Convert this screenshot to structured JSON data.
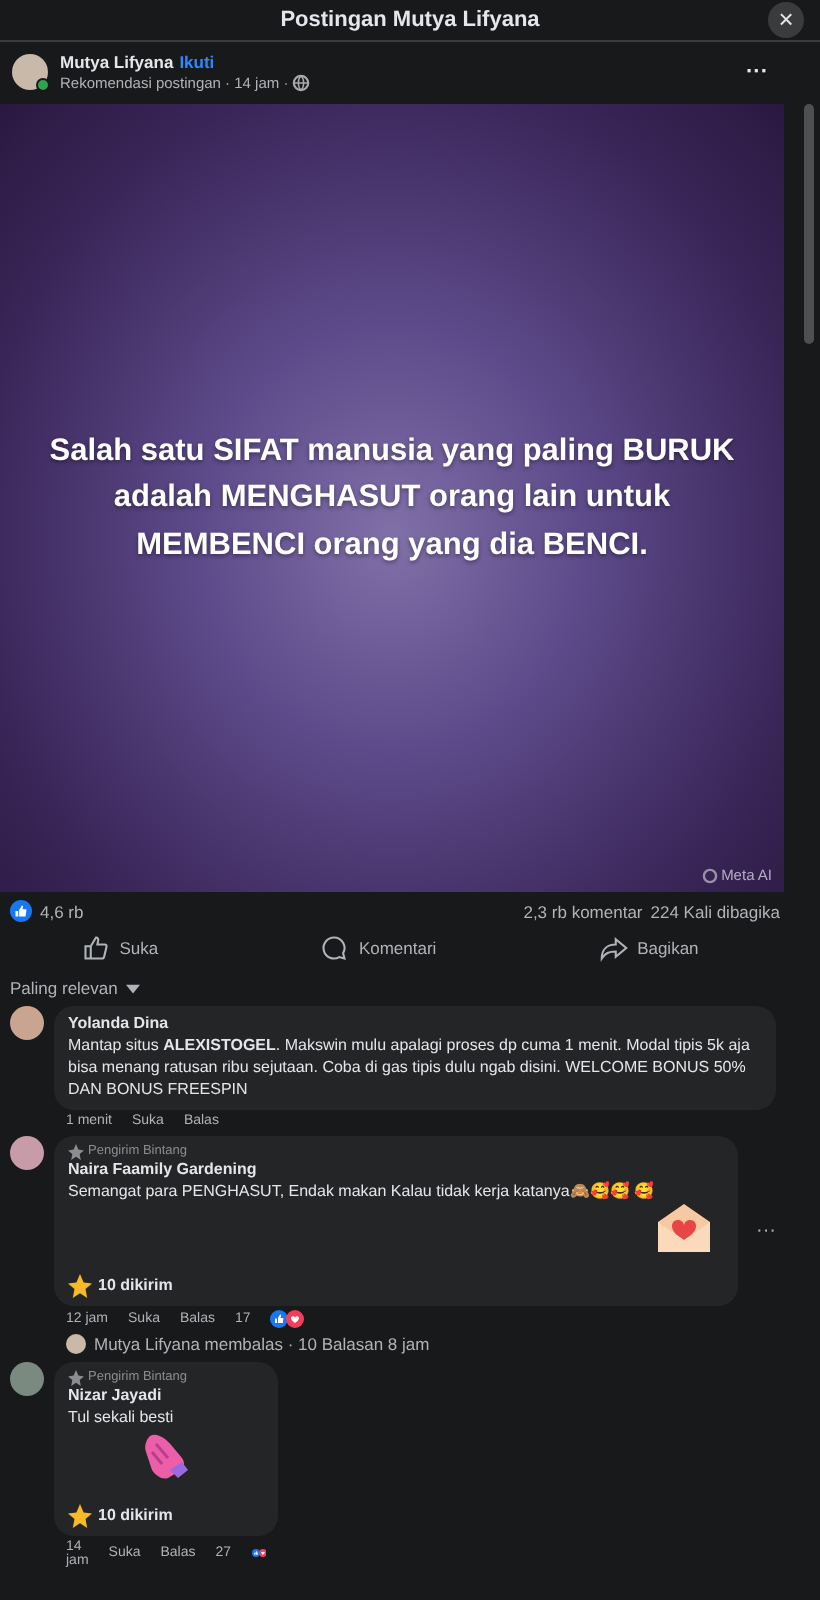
{
  "dialog": {
    "title": "Postingan Mutya Lifyana",
    "close": "×"
  },
  "post": {
    "author": "Mutya Lifyana",
    "follow": "Ikuti",
    "meta": "Rekomendasi postingan · 14 jam ·",
    "online": true,
    "menu": "···",
    "quote": "Salah satu SIFAT manusia yang paling BURUK adalah MENGHASUT orang lain untuk MEMBENCI orang yang dia BENCI.",
    "badge": "Meta AI"
  },
  "stats": {
    "reactions": "4,6 rb",
    "comments": "2,3 rb komentar",
    "shares": "224 Kali dibagika"
  },
  "actions": [
    {
      "label": "Suka",
      "kind": "like"
    },
    {
      "label": "Komentari",
      "kind": "comment"
    },
    {
      "label": "Bagikan",
      "kind": "share"
    }
  ],
  "sort": "Paling relevan",
  "comments": [
    {
      "author": "Yolanda Dina",
      "text": "Mantap situs **ALEXISTOGEL**. Makswin mulu apalagi proses dp cuma 1 menit. Modal tipis 5k aja bisa menang ratusan ribu sejutaan. Coba di gas tipis dulu ngab disini. WELCOME BONUS 50% DAN BONUS FREESPIN",
      "time": "1 menit",
      "like": "Suka",
      "reply": "Balas"
    },
    {
      "badge": "Pengirim Bintang",
      "author": "Naira Faamily Gardening",
      "text": "Semangat para PENGHASUT, Endak makan Kalau tidak kerja katanya🙈🥰🥰 🥰",
      "kind": "envelope",
      "stars": "10 dikirim",
      "time": "12 jam",
      "like": "Suka",
      "reply": "Balas",
      "count": "17",
      "menu": "···",
      "replies_note": "Mutya Lifyana membalas · 10 Balasan 8 jam"
    },
    {
      "badge": "Pengirim Bintang",
      "author": "Nizar Jayadi",
      "text": "Tul sekali besti",
      "kind": "hand",
      "stars": "10 dikirim",
      "time": "14 jam",
      "like": "Suka",
      "reply": "Balas",
      "count": "27"
    }
  ]
}
